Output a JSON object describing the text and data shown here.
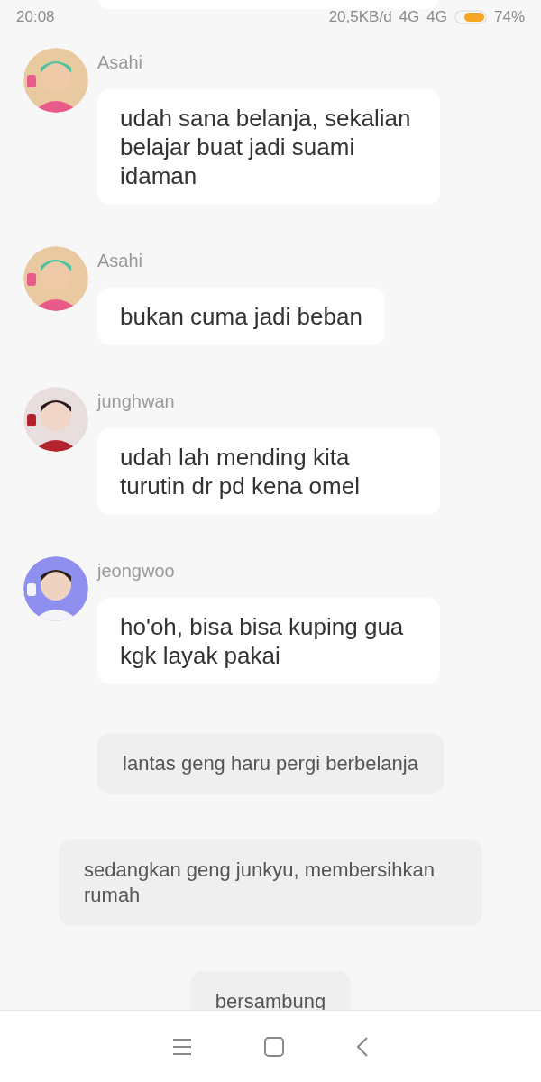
{
  "status_bar": {
    "time": "20:08",
    "speed": "20,5KB/d",
    "network_1": "4G",
    "network_2": "4G",
    "battery": "74%"
  },
  "messages": [
    {
      "kind": "chat",
      "sender": "Asahi",
      "text": "udah sana belanja, sekalian belajar buat jadi suami idaman"
    },
    {
      "kind": "chat",
      "sender": "Asahi",
      "text": "bukan cuma jadi beban"
    },
    {
      "kind": "chat",
      "sender": "junghwan",
      "text": "udah lah mending kita turutin dr pd kena omel"
    },
    {
      "kind": "chat",
      "sender": "jeongwoo",
      "text": "ho'oh, bisa bisa kuping gua kgk layak pakai"
    },
    {
      "kind": "narration",
      "text": "lantas geng haru pergi berbelanja"
    },
    {
      "kind": "narration",
      "text": "sedangkan geng junkyu, membersihkan rumah"
    },
    {
      "kind": "narration",
      "text": "bersambung"
    }
  ]
}
